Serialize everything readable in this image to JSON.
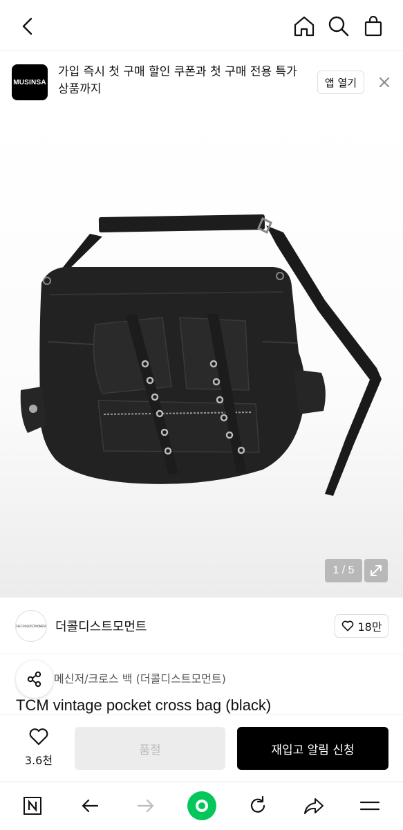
{
  "header": {
    "back_icon": "chevron-left-icon",
    "home_icon": "home-icon",
    "search_icon": "search-icon",
    "cart_icon": "shopping-bag-icon"
  },
  "banner": {
    "logo_text": "MUSINSA",
    "message": "가입 즉시 첫 구매 할인 쿠폰과 첫 구매 전용 특가 상품까지",
    "open_app_label": "앱 열기",
    "close_icon": "close-icon"
  },
  "gallery": {
    "counter": "1 / 5",
    "current_index": 1,
    "total": 5,
    "expand_icon": "expand-icon"
  },
  "brand": {
    "logo_text": "THECOOLDISTMOMENT",
    "name": "더콜디스트모먼트",
    "likes": "18만"
  },
  "product": {
    "category": "메신저/크로스 백 (더콜디스트모먼트)",
    "title": "TCM vintage pocket cross bag (black)"
  },
  "action_bar": {
    "wishlist_count": "3.6천",
    "soldout_label": "품절",
    "restock_label": "재입고 알림 신청"
  },
  "browser_nav": {
    "items": [
      "naver-icon",
      "back-arrow-icon",
      "forward-arrow-icon",
      "green-dot-icon",
      "refresh-icon",
      "share-icon",
      "menu-icon"
    ]
  },
  "colors": {
    "primary_button": "#000000",
    "disabled_button": "#ececec",
    "naver_green": "#03c75a"
  }
}
